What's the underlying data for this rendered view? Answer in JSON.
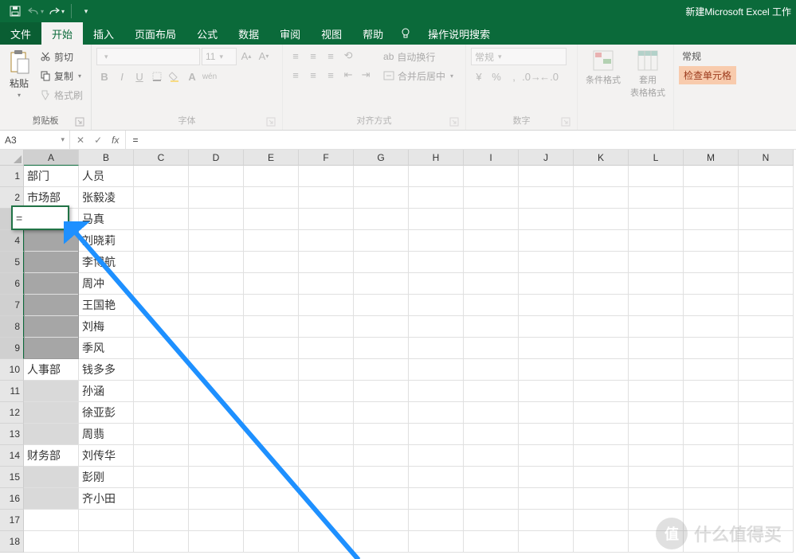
{
  "app_title": "新建Microsoft Excel 工作",
  "tabs": {
    "file": "文件",
    "home": "开始",
    "insert": "插入",
    "layout": "页面布局",
    "formulas": "公式",
    "data": "数据",
    "review": "审阅",
    "view": "视图",
    "help": "帮助",
    "search": "操作说明搜索"
  },
  "ribbon": {
    "clipboard": {
      "paste": "粘贴",
      "cut": "剪切",
      "copy": "复制",
      "painter": "格式刷",
      "label": "剪贴板"
    },
    "font": {
      "name": "",
      "size": "11",
      "label": "字体",
      "bold": "B",
      "italic": "I",
      "underline": "U",
      "ruby": "wén"
    },
    "align": {
      "wrap": "自动换行",
      "merge": "合并后居中",
      "label": "对齐方式"
    },
    "number": {
      "format": "常规",
      "label": "数字"
    },
    "styles": {
      "cond": "条件格式",
      "table": "套用\n表格格式"
    },
    "number_fmt": {
      "title": "常规",
      "check": "检查单元格"
    }
  },
  "namebox": "A3",
  "fx": {
    "cancel": "✕",
    "ok": "✓",
    "fx": "fx"
  },
  "formula": "=",
  "columns": [
    "A",
    "B",
    "C",
    "D",
    "E",
    "F",
    "G",
    "H",
    "I",
    "J",
    "K",
    "L",
    "M",
    "N"
  ],
  "rows": [
    1,
    2,
    3,
    4,
    5,
    6,
    7,
    8,
    9,
    10,
    11,
    12,
    13,
    14,
    15,
    16,
    17,
    18
  ],
  "cells": {
    "A1": "部门",
    "B1": "人员",
    "A2": "市场部",
    "B2": "张毅凌",
    "B3": "马真",
    "B4": "刘晓莉",
    "B5": "李博航",
    "B6": "周冲",
    "B7": "王国艳",
    "B8": "刘梅",
    "B9": "季风",
    "A10": "人事部",
    "B10": "钱多多",
    "B11": "孙涵",
    "B12": "徐亚彭",
    "B13": "周翡",
    "A14": "财务部",
    "B14": "刘传华",
    "B15": "彭刚",
    "B16": "齐小田"
  },
  "edit_value": "=",
  "watermark": {
    "badge": "值",
    "text": "什么值得买"
  }
}
